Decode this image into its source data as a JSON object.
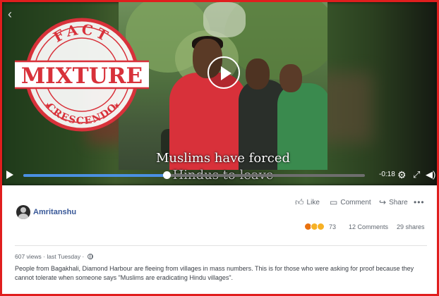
{
  "video": {
    "caption_line1": "Muslims have  forced",
    "caption_line2": "Hindus to leave",
    "time_remaining": "-0:18",
    "progress": 0.42
  },
  "stamp": {
    "top_text": "FACT",
    "main_text": "MIXTURE",
    "bottom_text": "CRESCENDO",
    "color": "#d8313a"
  },
  "post": {
    "author": "Amritanshu",
    "actions": {
      "like": "Like",
      "comment": "Comment",
      "share": "Share"
    },
    "reaction_count": "73",
    "comments_count": "12 Comments",
    "shares_count": "29 shares",
    "views_meta": "607 views · last Tuesday ·",
    "text": "People from Bagakhali, Diamond Harbour are fleeing from villages in mass numbers. This is for those who were asking for proof because they cannot tolerate when someone says \"Muslims are eradicating Hindu villages\"."
  },
  "colors": {
    "frame_border": "#e01e1e",
    "author_link": "#385898",
    "progress_fill": "#4a90e2"
  },
  "icons": [
    "back-arrow-icon",
    "play-icon",
    "gear-icon",
    "expand-icon",
    "volume-icon",
    "like-icon",
    "comment-icon",
    "share-icon",
    "globe-icon"
  ]
}
